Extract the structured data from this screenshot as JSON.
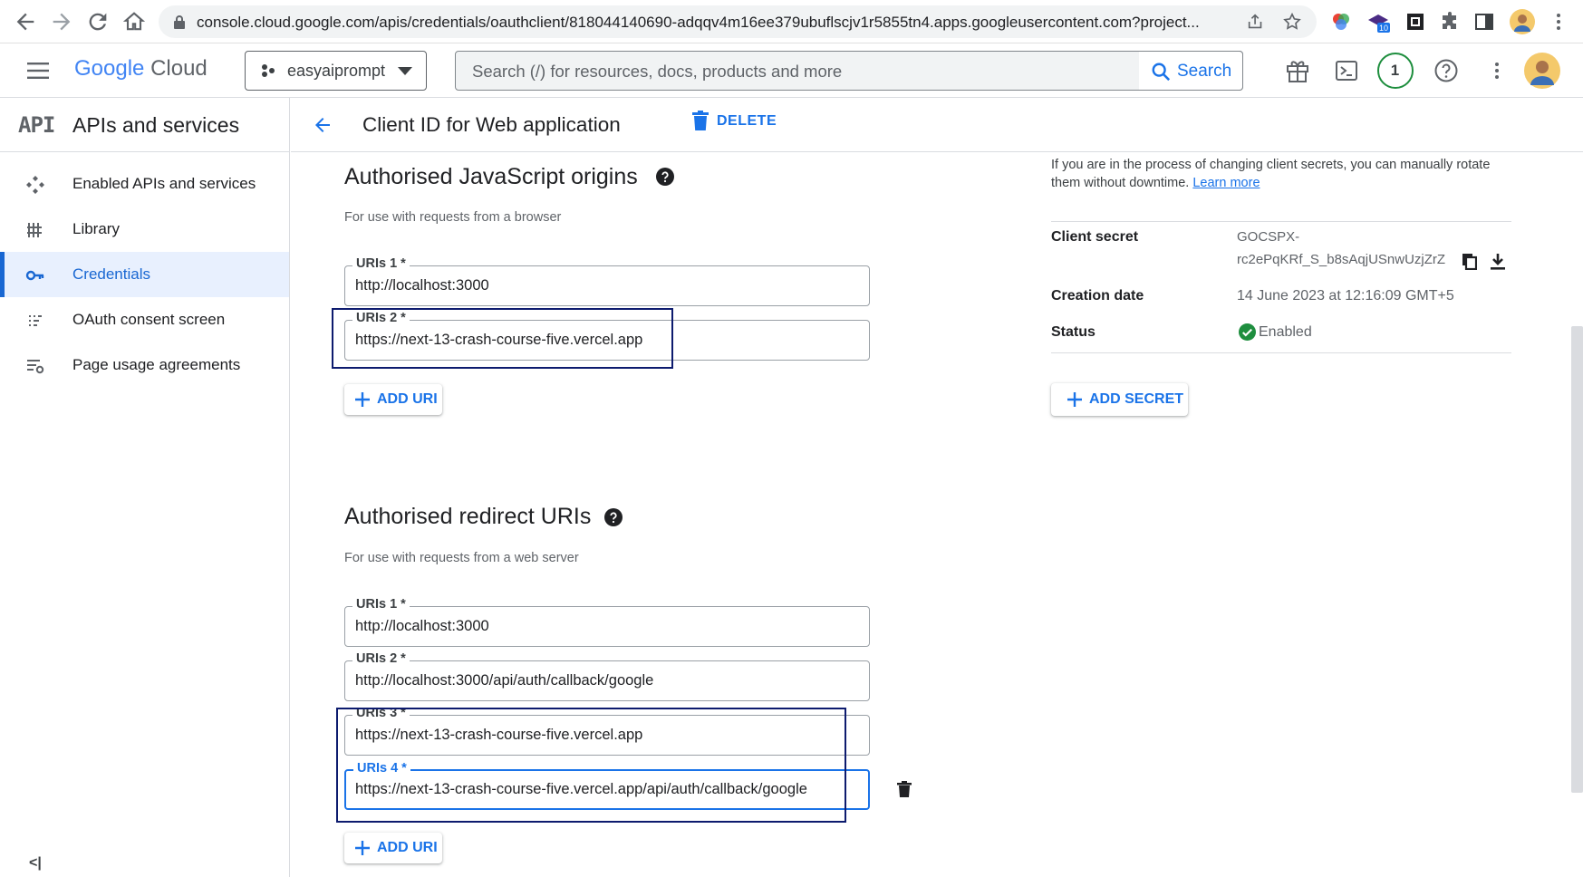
{
  "browser": {
    "url": "console.cloud.google.com/apis/credentials/oauthclient/818044140690-adqqv4m16ee379ubuflscjv1r5855tn4.apps.googleusercontent.com?project..."
  },
  "header": {
    "logo_google": "Google",
    "logo_cloud": "Cloud",
    "project": "easyaiprompt",
    "search_placeholder": "Search (/) for resources, docs, products and more",
    "search_button": "Search",
    "notification_count": "1"
  },
  "sidebar": {
    "badge": "API",
    "title": "APIs and services",
    "items": [
      {
        "label": "Enabled APIs and services",
        "icon": "hub-icon"
      },
      {
        "label": "Library",
        "icon": "library-icon"
      },
      {
        "label": "Credentials",
        "icon": "key-icon"
      },
      {
        "label": "OAuth consent screen",
        "icon": "consent-icon"
      },
      {
        "label": "Page usage agreements",
        "icon": "settings-list-icon"
      }
    ],
    "active_index": 2
  },
  "page": {
    "title": "Client ID for Web application",
    "delete_label": "DELETE"
  },
  "js_origins": {
    "title": "Authorised JavaScript origins",
    "subtitle": "For use with requests from a browser",
    "uris": [
      {
        "label": "URIs 1 *",
        "value": "http://localhost:3000"
      },
      {
        "label": "URIs 2 *",
        "value": "https://next-13-crash-course-five.vercel.app"
      }
    ],
    "add_label": "ADD URI"
  },
  "redirect": {
    "title": "Authorised redirect URIs",
    "subtitle": "For use with requests from a web server",
    "uris": [
      {
        "label": "URIs 1 *",
        "value": "http://localhost:3000"
      },
      {
        "label": "URIs 2 *",
        "value": "http://localhost:3000/api/auth/callback/google"
      },
      {
        "label": "URIs 3 *",
        "value": "https://next-13-crash-course-five.vercel.app"
      },
      {
        "label": "URIs 4 *",
        "value": "https://next-13-crash-course-five.vercel.app/api/auth/callback/google"
      }
    ],
    "add_label": "ADD URI"
  },
  "secrets": {
    "note_line1": "If you are in the process of changing client secrets, you can manually rotate",
    "note_line2": "them without downtime.",
    "learn_more": "Learn more",
    "client_secret_key": "Client secret",
    "client_secret_line1": "GOCSPX-",
    "client_secret_line2": "rc2ePqKRf_S_b8sAqjUSnwUzjZrZ",
    "creation_date_key": "Creation date",
    "creation_date_value": "14 June 2023 at 12:16:09 GMT+5",
    "status_key": "Status",
    "status_value": "Enabled",
    "add_secret_label": "ADD SECRET"
  },
  "colors": {
    "accent": "#1a73e8",
    "highlight_box": "#0d1b6e",
    "enabled_green": "#1e8e3e"
  }
}
